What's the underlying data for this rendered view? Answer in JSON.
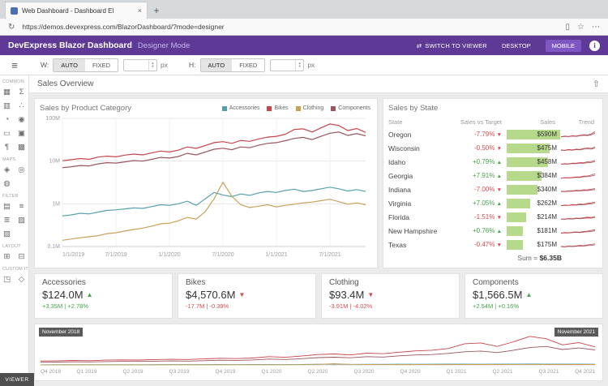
{
  "browser": {
    "tab_title": "Web Dashboard - Dashboard El",
    "close_glyph": "×",
    "new_tab_glyph": "+",
    "refresh_glyph": "↻",
    "url": "https://demos.devexpress.com/BlazorDashboard/?mode=designer",
    "reading_glyph": "▯",
    "star_glyph": "☆",
    "more_glyph": "⋯"
  },
  "header": {
    "title": "DevExpress Blazor Dashboard",
    "mode": "Designer Mode",
    "switch_icon": "⇄",
    "switch_label": "SWITCH TO VIEWER",
    "desktop_label": "DESKTOP",
    "mobile_label": "MOBILE",
    "info_glyph": "i"
  },
  "toolbar": {
    "menu_glyph": "≡",
    "w_label": "W:",
    "h_label": "H:",
    "auto_label": "AUTO",
    "fixed_label": "FIXED",
    "px_label": "px",
    "width_value": "",
    "height_value": "",
    "spin_up": "▴",
    "spin_down": "▾"
  },
  "sidebar": {
    "viewer_label": "VIEWER",
    "sections": [
      {
        "label": "COMMON",
        "icons": [
          {
            "name": "grid-icon",
            "glyph": "▦"
          },
          {
            "name": "pivot-icon",
            "glyph": "Σ"
          },
          {
            "name": "chart-icon",
            "glyph": "▥"
          },
          {
            "name": "scatter-chart-icon",
            "glyph": "∴"
          },
          {
            "name": "pie-icon",
            "glyph": "◔"
          },
          {
            "name": "gauge-icon",
            "glyph": "◉"
          },
          {
            "name": "card-icon",
            "glyph": "▭"
          },
          {
            "name": "image-icon",
            "glyph": "▣"
          },
          {
            "name": "text-box-icon",
            "glyph": "¶"
          },
          {
            "name": "treemap-icon",
            "glyph": "▩"
          }
        ]
      },
      {
        "label": "MAPS",
        "icons": [
          {
            "name": "choropleth-map-icon",
            "glyph": "◈"
          },
          {
            "name": "geo-point-map-icon",
            "glyph": "◎"
          },
          {
            "name": "bubble-map-icon",
            "glyph": "◍"
          }
        ]
      },
      {
        "label": "FILTER",
        "icons": [
          {
            "name": "combo-box-icon",
            "glyph": "▤"
          },
          {
            "name": "list-box-icon",
            "glyph": "≡"
          },
          {
            "name": "tree-view-icon",
            "glyph": "≣"
          },
          {
            "name": "date-filter-icon",
            "glyph": "▧"
          },
          {
            "name": "range-filter-icon",
            "glyph": "▨"
          }
        ]
      },
      {
        "label": "LAYOUT",
        "icons": [
          {
            "name": "group-icon",
            "glyph": "⊞"
          },
          {
            "name": "tab-container-icon",
            "glyph": "⊟"
          }
        ]
      },
      {
        "label": "CUSTOM ITEMS",
        "icons": [
          {
            "name": "webpage-icon",
            "glyph": "◳"
          },
          {
            "name": "custom-item-icon",
            "glyph": "◇"
          }
        ]
      }
    ]
  },
  "overview": {
    "title": "Sales Overview",
    "export_glyph": "⇧"
  },
  "chart_data": [
    {
      "type": "line",
      "title": "Sales by Product Category",
      "y_scale": "log",
      "unit": "M",
      "y_ticks": [
        {
          "value": 100,
          "label": "100M"
        },
        {
          "value": 10,
          "label": "10M"
        },
        {
          "value": 1,
          "label": "1M"
        },
        {
          "value": 0.1,
          "label": "0.1M"
        }
      ],
      "x_ticks": [
        "1/1/2019",
        "7/1/2019",
        "1/1/2020",
        "7/1/2020",
        "1/1/2021",
        "7/1/2021"
      ],
      "x_tick_indices": [
        0,
        6,
        12,
        18,
        24,
        30
      ],
      "legend_position": "top-right",
      "series": [
        {
          "name": "Accessories",
          "color": "#55a1ab",
          "values": [
            0.52,
            0.55,
            0.6,
            0.58,
            0.64,
            0.7,
            0.72,
            0.76,
            0.8,
            0.78,
            0.86,
            0.95,
            0.92,
            1.0,
            1.15,
            0.92,
            1.3,
            1.85,
            1.6,
            1.48,
            1.7,
            1.58,
            1.8,
            1.95,
            1.85,
            2.05,
            2.2,
            1.95,
            2.05,
            2.25,
            2.45,
            2.25,
            2.0,
            2.15,
            1.95
          ]
        },
        {
          "name": "Bikes",
          "color": "#c9444a",
          "values": [
            10.2,
            10.8,
            11.5,
            11.0,
            12.4,
            13.1,
            12.6,
            13.8,
            14.6,
            14.0,
            15.5,
            17.2,
            16.4,
            18.0,
            21.5,
            19.8,
            23.0,
            27.0,
            28.5,
            26.0,
            30.5,
            29.0,
            33.0,
            36.5,
            38.0,
            42.5,
            55.0,
            57.0,
            48.0,
            60.0,
            74.0,
            68.0,
            52.0,
            58.0,
            47.0
          ]
        },
        {
          "name": "Clothing",
          "color": "#c9a05a",
          "values": [
            0.14,
            0.15,
            0.16,
            0.17,
            0.18,
            0.2,
            0.21,
            0.23,
            0.25,
            0.27,
            0.3,
            0.34,
            0.35,
            0.4,
            0.48,
            0.44,
            0.65,
            1.3,
            3.2,
            1.5,
            0.95,
            0.82,
            0.88,
            0.95,
            0.85,
            0.92,
            0.98,
            1.05,
            1.1,
            1.18,
            1.28,
            1.12,
            0.98,
            1.05,
            0.95
          ]
        },
        {
          "name": "Components",
          "color": "#9a545e",
          "values": [
            7.0,
            7.4,
            7.9,
            7.7,
            8.6,
            9.2,
            9.0,
            9.6,
            10.3,
            10.0,
            11.0,
            12.2,
            11.8,
            12.8,
            15.2,
            14.0,
            16.2,
            19.0,
            20.0,
            18.5,
            21.5,
            20.5,
            23.5,
            26.0,
            27.0,
            30.0,
            34.0,
            36.0,
            32.0,
            38.0,
            45.0,
            48.0,
            40.0,
            44.0,
            39.0
          ]
        }
      ]
    },
    {
      "type": "line",
      "role": "range-selector",
      "series_ref": 0,
      "y_max": 80,
      "badge_left": "November 2018",
      "badge_right": "November 2021",
      "x_ticks": [
        "Q4 2018",
        "Q1 2019",
        "Q2 2019",
        "Q3 2019",
        "Q4 2019",
        "Q1 2020",
        "Q2 2020",
        "Q3 2020",
        "Q4 2020",
        "Q1 2021",
        "Q2 2021",
        "Q3 2021",
        "Q4 2021"
      ]
    }
  ],
  "sales_by_state": {
    "title": "Sales by State",
    "columns": [
      "State",
      "Sales vs Target",
      "Sales",
      "Trend"
    ],
    "max_sales": 590,
    "up_glyph": "▲",
    "down_glyph": "▼",
    "rows": [
      {
        "state": "Oregon",
        "vs_target": "-7.79%",
        "dir": "down",
        "sales": "$590M",
        "sales_value": 590,
        "trend": [
          0.2,
          0.3,
          0.25,
          0.35,
          0.3,
          0.4,
          0.5,
          0.45,
          0.6,
          0.9
        ]
      },
      {
        "state": "Wisconsin",
        "vs_target": "-0.50%",
        "dir": "down",
        "sales": "$475M",
        "sales_value": 475,
        "trend": [
          0.3,
          0.25,
          0.35,
          0.3,
          0.4,
          0.35,
          0.5,
          0.55,
          0.5,
          0.7
        ]
      },
      {
        "state": "Idaho",
        "vs_target": "+0.79%",
        "dir": "up",
        "sales": "$458M",
        "sales_value": 458,
        "trend": [
          0.25,
          0.3,
          0.28,
          0.38,
          0.35,
          0.45,
          0.42,
          0.55,
          0.6,
          0.75
        ]
      },
      {
        "state": "Georgia",
        "vs_target": "+7.91%",
        "dir": "up",
        "sales": "$384M",
        "sales_value": 384,
        "trend": [
          0.2,
          0.28,
          0.26,
          0.3,
          0.38,
          0.36,
          0.48,
          0.5,
          0.62,
          0.8
        ]
      },
      {
        "state": "Indiana",
        "vs_target": "-7.00%",
        "dir": "down",
        "sales": "$340M",
        "sales_value": 340,
        "trend": [
          0.3,
          0.28,
          0.36,
          0.34,
          0.42,
          0.4,
          0.5,
          0.48,
          0.58,
          0.66
        ]
      },
      {
        "state": "Virginia",
        "vs_target": "+7.05%",
        "dir": "up",
        "sales": "$262M",
        "sales_value": 262,
        "trend": [
          0.22,
          0.3,
          0.27,
          0.36,
          0.33,
          0.44,
          0.4,
          0.52,
          0.58,
          0.72
        ]
      },
      {
        "state": "Florida",
        "vs_target": "-1.51%",
        "dir": "down",
        "sales": "$214M",
        "sales_value": 214,
        "trend": [
          0.28,
          0.26,
          0.34,
          0.3,
          0.4,
          0.38,
          0.46,
          0.52,
          0.48,
          0.62
        ]
      },
      {
        "state": "New Hampshire",
        "vs_target": "+0.76%",
        "dir": "up",
        "sales": "$181M",
        "sales_value": 181,
        "trend": [
          0.24,
          0.3,
          0.28,
          0.34,
          0.4,
          0.36,
          0.46,
          0.5,
          0.6,
          0.7
        ]
      },
      {
        "state": "Texas",
        "vs_target": "-0.47%",
        "dir": "down",
        "sales": "$175M",
        "sales_value": 175,
        "trend": [
          0.3,
          0.26,
          0.34,
          0.32,
          0.38,
          0.42,
          0.4,
          0.5,
          0.55,
          0.65
        ]
      }
    ],
    "footer_label": "Sum = ",
    "footer_value": "$6.35B"
  },
  "summary_cards": [
    {
      "title": "Accessories",
      "value": "$124.0M",
      "dir": "up",
      "delta": "+3.35M | +2.78%"
    },
    {
      "title": "Bikes",
      "value": "$4,570.6M",
      "dir": "down",
      "delta": "-17.7M | -0.39%"
    },
    {
      "title": "Clothing",
      "value": "$93.4M",
      "dir": "down",
      "delta": "-3.91M | -4.02%"
    },
    {
      "title": "Components",
      "value": "$1,566.5M",
      "dir": "up",
      "delta": "+2.54M | +0.16%"
    }
  ],
  "theme": {
    "purple": "#5e3a96",
    "purple_light": "#7e57c2",
    "positive": "#44a248",
    "negative": "#d8494d",
    "bar_green": "#b6d98c"
  }
}
